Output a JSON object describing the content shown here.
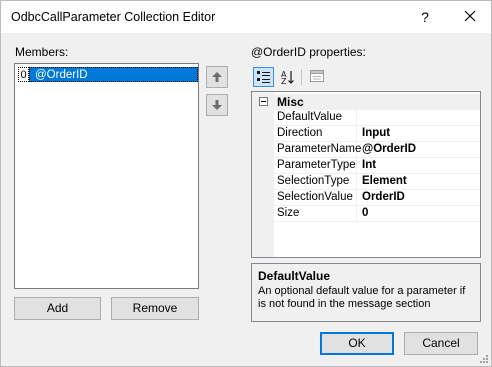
{
  "window": {
    "title": "OdbcCallParameter Collection Editor",
    "help_glyph": "?",
    "close_icon": "close-icon"
  },
  "members": {
    "label": "Members:",
    "items": [
      {
        "index": "0",
        "name": "@OrderID",
        "selected": true
      }
    ],
    "move_up_icon": "arrow-up-icon",
    "move_down_icon": "arrow-down-icon",
    "add_label": "Add",
    "remove_label": "Remove"
  },
  "properties": {
    "label": "@OrderID properties:",
    "toolbar": {
      "categorized_icon": "categorized-icon",
      "alphabetical_icon": "alphabetical-sort-icon",
      "property_pages_icon": "property-pages-icon"
    },
    "category": "Misc",
    "rows": [
      {
        "name": "DefaultValue",
        "value": ""
      },
      {
        "name": "Direction",
        "value": "Input"
      },
      {
        "name": "ParameterName",
        "value": "@OrderID"
      },
      {
        "name": "ParameterType",
        "value": "Int"
      },
      {
        "name": "SelectionType",
        "value": "Element"
      },
      {
        "name": "SelectionValue",
        "value": "OrderID"
      },
      {
        "name": "Size",
        "value": "0"
      }
    ],
    "help": {
      "title": "DefaultValue",
      "description": "An optional default value for a parameter if is not found in the message section"
    }
  },
  "footer": {
    "ok_label": "OK",
    "cancel_label": "Cancel"
  },
  "colors": {
    "selection": "#0078d7",
    "window_bg": "#f0f0f0",
    "button_bg": "#e1e1e1",
    "default_button_border": "#0078d7"
  }
}
